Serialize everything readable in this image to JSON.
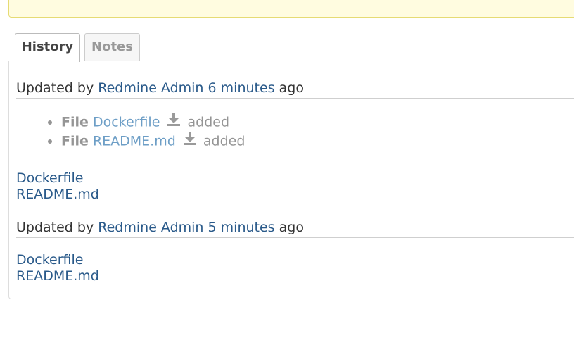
{
  "tabs": [
    {
      "label": "History",
      "active": true
    },
    {
      "label": "Notes",
      "active": false
    }
  ],
  "journals": [
    {
      "updated_by_prefix": "Updated by",
      "author": "Redmine Admin",
      "time_ago": "6 minutes",
      "suffix": "ago",
      "details": [
        {
          "label": "File",
          "filename": "Dockerfile",
          "action": "added",
          "icon": "download-icon"
        },
        {
          "label": "File",
          "filename": "README.md",
          "action": "added",
          "icon": "download-icon"
        }
      ],
      "attachments": [
        "Dockerfile",
        "README.md"
      ]
    },
    {
      "updated_by_prefix": "Updated by",
      "author": "Redmine Admin",
      "time_ago": "5 minutes",
      "suffix": "ago",
      "attachments": [
        "Dockerfile",
        "README.md"
      ]
    }
  ],
  "colors": {
    "link": "#2a5a8a",
    "detail_link": "#6d9ec6",
    "detail_text": "#959595",
    "flash_bg": "#fffce0"
  }
}
